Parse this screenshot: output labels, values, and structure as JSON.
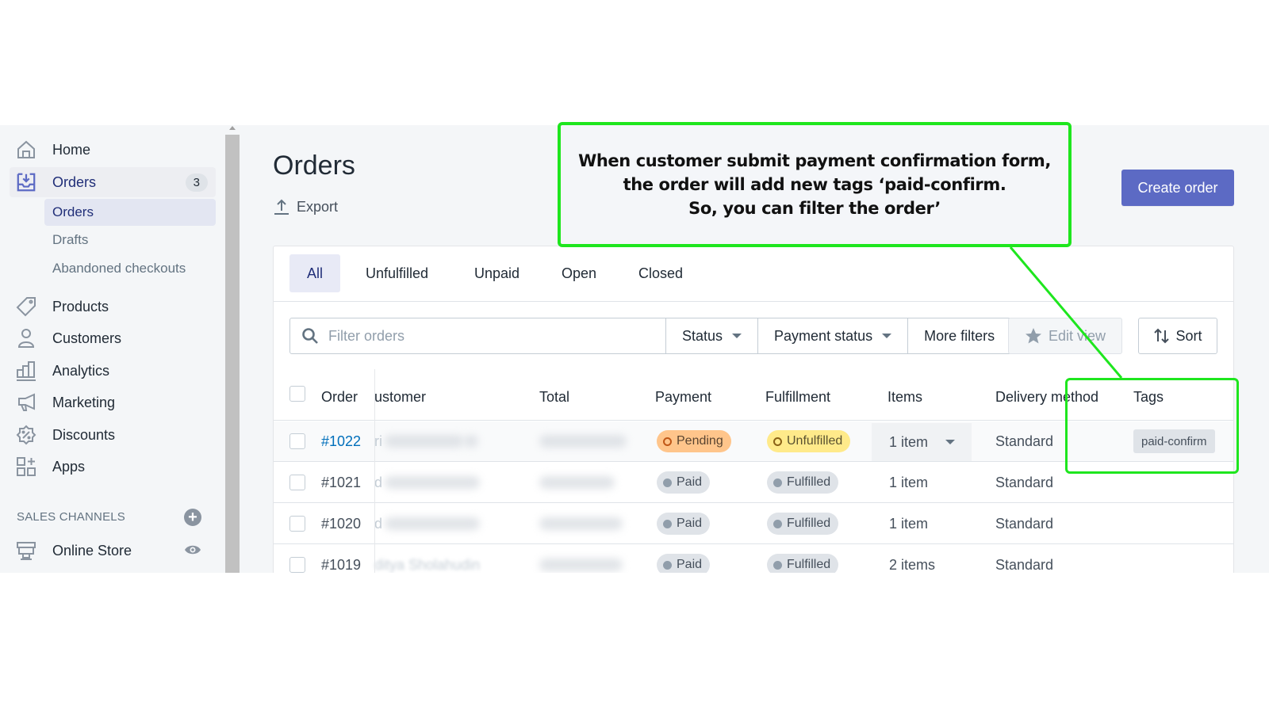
{
  "sidebar": {
    "nav": [
      {
        "label": "Home",
        "icon": "home-icon"
      },
      {
        "label": "Orders",
        "icon": "orders-inbox-icon",
        "badge": "3",
        "active": true
      },
      {
        "label": "Products",
        "icon": "tag-icon"
      },
      {
        "label": "Customers",
        "icon": "person-icon"
      },
      {
        "label": "Analytics",
        "icon": "bar-chart-icon"
      },
      {
        "label": "Marketing",
        "icon": "megaphone-icon"
      },
      {
        "label": "Discounts",
        "icon": "discount-icon"
      },
      {
        "label": "Apps",
        "icon": "apps-icon"
      }
    ],
    "orders_sub": [
      {
        "label": "Orders",
        "active": true
      },
      {
        "label": "Drafts"
      },
      {
        "label": "Abandoned checkouts"
      }
    ],
    "sales_channels_heading": "SALES CHANNELS",
    "online_store": {
      "label": "Online Store",
      "icon": "store-icon"
    }
  },
  "header": {
    "title": "Orders",
    "export_label": "Export",
    "create_label": "Create order"
  },
  "tabs": [
    "All",
    "Unfulfilled",
    "Unpaid",
    "Open",
    "Closed"
  ],
  "filters": {
    "search_placeholder": "Filter orders",
    "status_label": "Status",
    "payment_status_label": "Payment status",
    "more_filters_label": "More filters",
    "edit_view_label": "Edit view",
    "sort_label": "Sort"
  },
  "table": {
    "columns": [
      "Order",
      "ustomer",
      "Total",
      "Payment",
      "Fulfillment",
      "Items",
      "Delivery method",
      "Tags"
    ],
    "rows": [
      {
        "order": "#1022",
        "customer_visible": "ri",
        "payment": "Pending",
        "fulfillment": "Unfulfilled",
        "items": "1 item",
        "delivery": "Standard",
        "tag": "paid-confirm"
      },
      {
        "order": "#1021",
        "customer_visible": "d",
        "payment": "Paid",
        "fulfillment": "Fulfilled",
        "items": "1 item",
        "delivery": "Standard",
        "tag": ""
      },
      {
        "order": "#1020",
        "customer_visible": "d",
        "payment": "Paid",
        "fulfillment": "Fulfilled",
        "items": "1 item",
        "delivery": "Standard",
        "tag": ""
      },
      {
        "order": "#1019",
        "customer_visible": "ditya Sholahudin",
        "payment": "Paid",
        "fulfillment": "Fulfilled",
        "items": "2 items",
        "delivery": "Standard",
        "tag": ""
      }
    ]
  },
  "annotation": {
    "line1": "When customer submit payment confirmation form,",
    "line2": "the order will add new tags ‘paid-confirm.",
    "line3": "So, you can filter the order’",
    "color": "#1ee61e"
  },
  "colors": {
    "primary": "#5c6ac4",
    "link": "#006fbb",
    "pending": "#ffc58b",
    "unfulfilled": "#ffea8a",
    "neutral_badge": "#dfe3e8"
  }
}
